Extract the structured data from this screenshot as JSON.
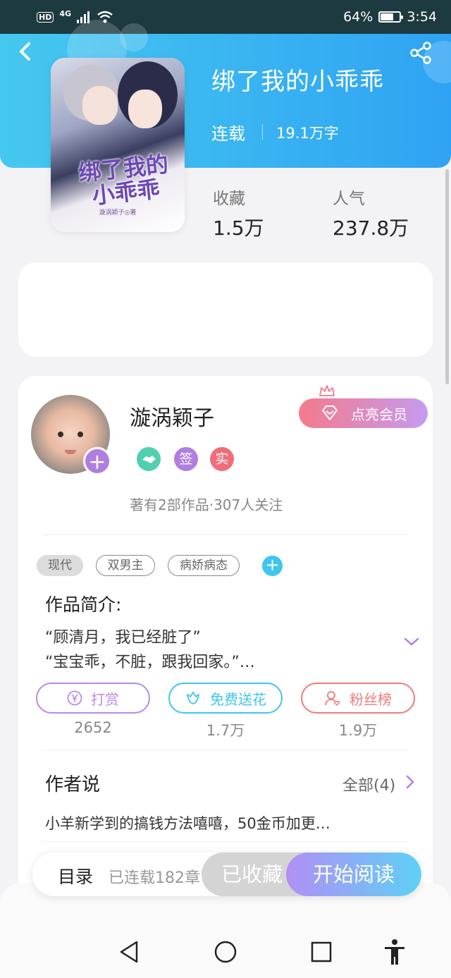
{
  "status_bar": {
    "left_badge": "HD",
    "network": "4G",
    "battery_pct": "64%",
    "battery_level": 0.64,
    "time": "3:54"
  },
  "book": {
    "title": "绑了我的小乖乖",
    "status": "连载",
    "word_count": "19.1万字",
    "cover_title": "绑了我的小乖乖",
    "cover_author": "漩涡颖子◎著",
    "stats": [
      {
        "label": "收藏",
        "value": "1.5万"
      },
      {
        "label": "人气",
        "value": "237.8万"
      }
    ]
  },
  "author": {
    "name": "漩涡颖子",
    "meta": "著有2部作品·307人关注",
    "badges": [
      {
        "icon": "handshake-icon",
        "text": "",
        "color": "#4fd0b0"
      },
      {
        "icon": "sign-badge",
        "text": "签",
        "color": "#b07ee0"
      },
      {
        "icon": "verified-badge",
        "text": "实",
        "color": "#f26d79"
      }
    ],
    "vip_label": "点亮会员"
  },
  "tags": [
    "现代",
    "双男主",
    "病娇病态"
  ],
  "intro": {
    "title": "作品简介:",
    "lines": [
      "“顾清月，我已经脏了”",
      "“宝宝乖，不脏，跟我回家。”…"
    ]
  },
  "actions": [
    {
      "icon": "yen-icon",
      "label": "打赏",
      "count": "2652",
      "color": "#b88be6"
    },
    {
      "icon": "flower-icon",
      "label": "免费送花",
      "count": "1.7万",
      "color": "#3ec6ef"
    },
    {
      "icon": "fan-icon",
      "label": "粉丝榜",
      "count": "1.9万",
      "color": "#ef7b7b"
    }
  ],
  "author_says": {
    "title": "作者说",
    "all_label": "全部(4)",
    "text": "小羊新学到的搞钱方法嘻嘻，50金币加更…"
  },
  "bottom_bar": {
    "toc_label": "目录",
    "chapter_count": "已连载182章",
    "fav_label": "已收藏",
    "read_label": "开始阅读"
  },
  "colors": {
    "header_start": "#45c8ef",
    "header_end": "#2fa3f3",
    "accent_purple": "#b07ee0"
  }
}
